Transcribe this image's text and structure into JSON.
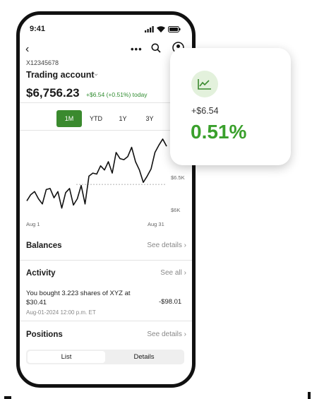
{
  "status": {
    "time": "9:41"
  },
  "header": {
    "more_label": "•••"
  },
  "account": {
    "number": "X12345678",
    "name": "Trading account",
    "balance": "$6,756.23",
    "change": "+$6.54 (+0.51%) today"
  },
  "timeframes": [
    {
      "label": "1M",
      "active": true
    },
    {
      "label": "YTD",
      "active": false
    },
    {
      "label": "1Y",
      "active": false
    },
    {
      "label": "3Y",
      "active": false
    }
  ],
  "chart_data": {
    "type": "line",
    "x_labels": [
      "Aug 1",
      "Aug 31"
    ],
    "y_ticks": [
      "$6.5K",
      "$6K"
    ],
    "ylim": [
      5950,
      6800
    ],
    "values": [
      6180,
      6240,
      6270,
      6200,
      6150,
      6290,
      6300,
      6210,
      6270,
      6110,
      6260,
      6300,
      6140,
      6200,
      6330,
      6150,
      6420,
      6450,
      6440,
      6520,
      6480,
      6560,
      6450,
      6650,
      6590,
      6580,
      6610,
      6700,
      6560,
      6480,
      6360,
      6420,
      6490,
      6650,
      6720,
      6780,
      6710
    ],
    "reference_line": 6340
  },
  "balances": {
    "title": "Balances",
    "link": "See details"
  },
  "activity": {
    "title": "Activity",
    "link": "See all",
    "text": "You bought 3.223 shares of XYZ at $30.41",
    "amount": "-$98.01",
    "date": "Aug-01-2024 12:00 p.m. ET"
  },
  "positions": {
    "title": "Positions",
    "link": "See details"
  },
  "segment": {
    "list": "List",
    "details": "Details"
  },
  "card": {
    "amount": "+$6.54",
    "percent": "0.51%"
  },
  "colors": {
    "accent": "#3a8a2e",
    "positive": "#3aa02c"
  }
}
